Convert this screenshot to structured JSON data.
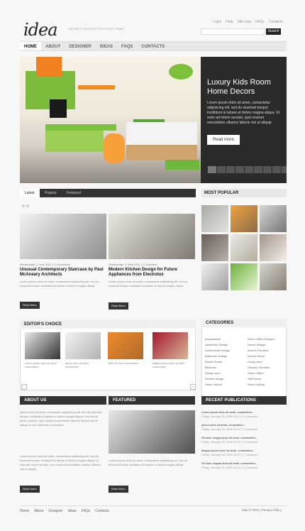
{
  "header": {
    "logo": "idea",
    "tagline": "THE BEST DESIGN FOR YOUR HOME",
    "links": [
      "Login",
      "Help",
      "Site map",
      "FAQs",
      "Contacts"
    ],
    "search_label": "Search"
  },
  "nav": [
    "HOME",
    "ABOUT",
    "DESIGNER",
    "IDEAS",
    "FAQS",
    "CONTACTS"
  ],
  "hero": {
    "title": "Luxury Kids Room Home Decors",
    "text": "Lorem ipsum dolor sit amet, consectetur adipisicing elit, sed do eiusmod tempor incididunt ut labore et dolore magna aliqua. Ut enim ad minim veniam, quis nostrud exercitation ullamco laboris nisi ut aliquip",
    "button": "Read more"
  },
  "tabs": [
    "Latest",
    "Popular",
    "Featured"
  ],
  "articles": [
    {
      "date": "Wednesday, 3 June 2011",
      "comments": "3 Comments",
      "title": "Unusual Contemporary Staircase by Paul McAneary Architects",
      "text": "Lorem ipsum dolor sit amet, consectetur adipisicing elit, sed do eiusmod tempor incididunt ut labore et dolore magna aliqua.",
      "button": "Read More"
    },
    {
      "date": "Wednesday, 3 June 2011",
      "comments": "1 Comment",
      "title": "Modern Kitchen Design for Future Appliances from Electrolux",
      "text": "Lorem ipsum dolor sit amet, consectetur adipisicing elit, sed do eiusmod tempor incididunt ut labore et dolore magna aliqua.",
      "button": "Read More"
    }
  ],
  "sidebar": {
    "most_popular": "MOST POPULAR",
    "categories_title": "CATEGORIES",
    "categories": [
      "Accessories",
      "Home Office Designs",
      "Apartment Design",
      "House Design",
      "Architecture Design",
      "Interior Furniture",
      "Bathroom Design",
      "Interior Decor",
      "Beach House",
      "Living room",
      "Bedroom",
      "Outdoor Furniture",
      "Dining room",
      "Home Office",
      "Kitchen design",
      "Wall Decor",
      "Home Interior",
      "Home Library"
    ],
    "recent_title": "RECENT PUBLICATIONS",
    "recent": [
      {
        "title": "Lorem ipsum dolor sit amet, consectetur...",
        "meta": "Friday, January 25, 2009 10:37 | 1 Comment"
      },
      {
        "title": "Ipsum dolor sit amet, consectetur...",
        "meta": "Friday, January 25, 2009 10:37 | 1 Comment"
      },
      {
        "title": "Sit dolor magna dolor sit amet, consectetur...",
        "meta": "Friday, January 25, 2009 10:37 | 1 Comment"
      },
      {
        "title": "Magna ipsum dolor sit amet, consectetur...",
        "meta": "Friday, January 25, 2009 10:37 | 1 Comment"
      },
      {
        "title": "Sit dolor magna dolor sit amet, consectetur...",
        "meta": "Friday, January 25, 2009 10:37 | 1 Comment"
      }
    ]
  },
  "editors_choice": {
    "title": "EDITOR'S CHOICE",
    "items": [
      "Lorem ipsum dolor sit amet consectetur",
      "Ipsum dolor sit amet consectetur",
      "Dolor sit amet consectetur",
      "Magna ipsum dolor sit amet consectetur"
    ]
  },
  "about": {
    "title": "ABOUT US",
    "text1": "Ipsum dolor sit amet, consectetur adipisicing elit, sed do eiusmod tempor incididunt ut labore et dolore magna aliqua. Ut enim ad minim veniam, quis nostrud exercitation ullamco laboris nisi ut aliquip ex ea commodo consequat.",
    "text2": "Lorem ipsum dolor sit amet, consectetur adipisicing elit, sed do eiusmod tempor incididunt ut labore et dolore magna aliqua. Ut enim ad minim veniam, quis nostrud exercitation ullamco laboris nisi ut aliquip.",
    "button": "Read More"
  },
  "featured": {
    "title": "FEATURED",
    "text": "Lorem ipsum dolor sit amet, consectetur adipisicing elit, sed do eiusmod tempor incididunt ut labore et dolore magna aliqua.",
    "button": "Read More"
  },
  "footer": {
    "links": [
      "Home",
      "About",
      "Designer",
      "Ideas",
      "FAQs",
      "Contacts"
    ],
    "copyright": "Idea © 2011 | Privacy Policy"
  }
}
